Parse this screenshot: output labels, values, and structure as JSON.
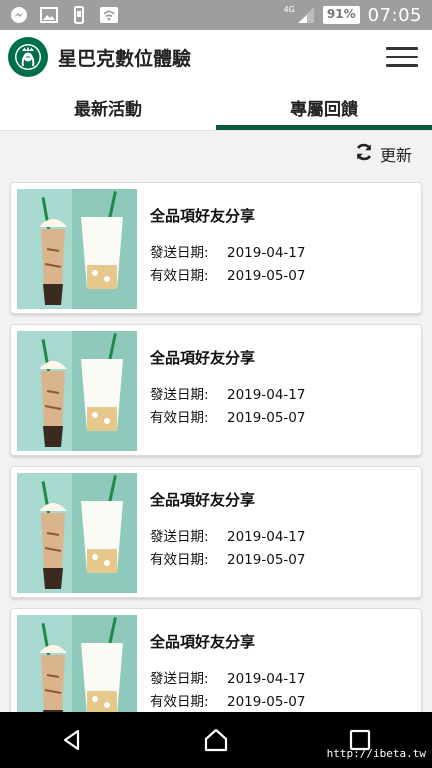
{
  "status_bar": {
    "battery": "91%",
    "time": "07:05",
    "network": "4G",
    "icons": [
      "messenger-icon",
      "image-icon",
      "phone-sync-icon",
      "wifi-icon",
      "signal-icon"
    ]
  },
  "app": {
    "title": "星巴克數位體驗",
    "brand_color": "#00704a"
  },
  "tabs": [
    {
      "label": "最新活動",
      "active": false
    },
    {
      "label": "專屬回饋",
      "active": true
    }
  ],
  "refresh": {
    "label": "更新",
    "icon": "refresh-icon"
  },
  "coupons": [
    {
      "title": "全品項好友分享",
      "sent_label": "發送日期:",
      "sent_date": "2019-04-17",
      "valid_label": "有效日期:",
      "valid_date": "2019-05-07"
    },
    {
      "title": "全品項好友分享",
      "sent_label": "發送日期:",
      "sent_date": "2019-04-17",
      "valid_label": "有效日期:",
      "valid_date": "2019-05-07"
    },
    {
      "title": "全品項好友分享",
      "sent_label": "發送日期:",
      "sent_date": "2019-04-17",
      "valid_label": "有效日期:",
      "valid_date": "2019-05-07"
    },
    {
      "title": "全品項好友分享",
      "sent_label": "發送日期:",
      "sent_date": "2019-04-17",
      "valid_label": "有效日期:",
      "valid_date": "2019-05-07"
    }
  ],
  "watermark": "http://ibeta.tw"
}
